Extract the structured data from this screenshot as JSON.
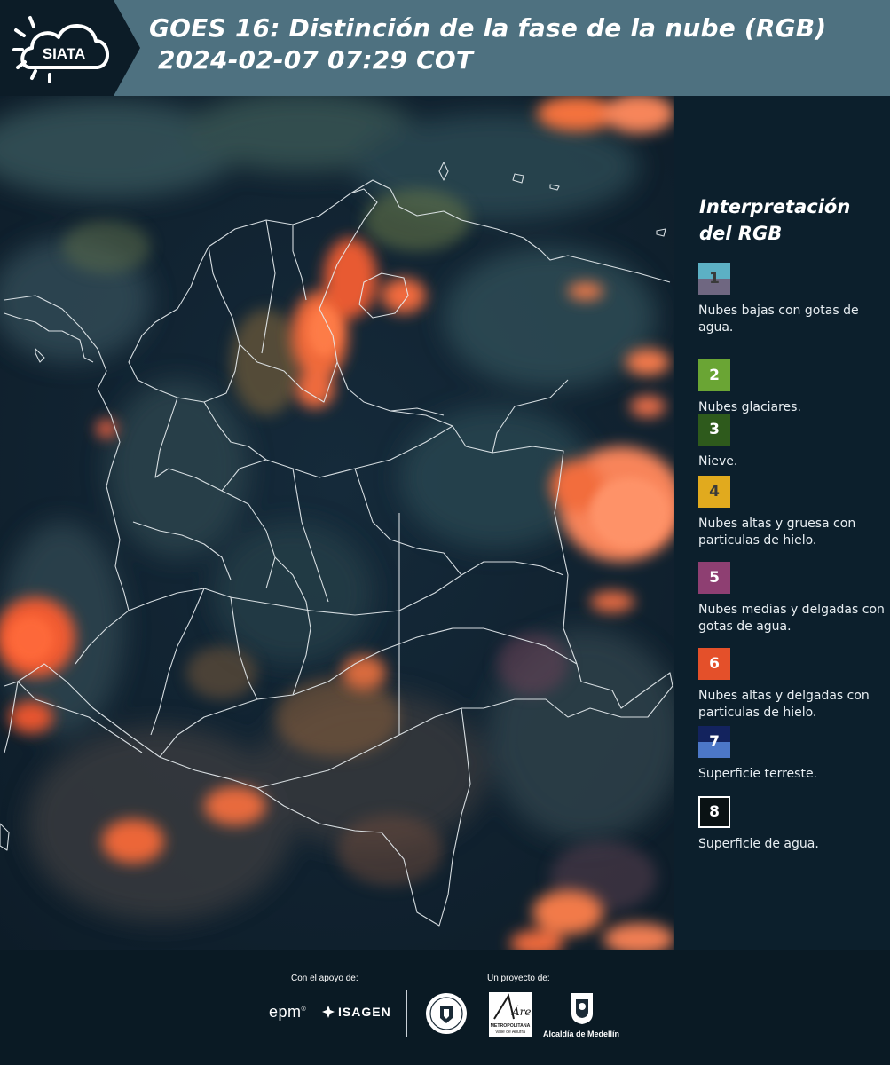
{
  "header": {
    "logo_text": "SIATA",
    "title_line1": "GOES 16: Distinción de la fase de la nube (RGB)",
    "title_line2": "2024-02-07 07:29 COT",
    "background_color": "#4e7180"
  },
  "legend": {
    "title_line1": "Interpretación",
    "title_line2": "del RGB",
    "items": [
      {
        "num": "1",
        "label": "Nubes bajas con gotas de agua.",
        "color_top": "#5cb0c4",
        "color_bottom": "#6f6781",
        "num_color": "#3a3a3a"
      },
      {
        "num": "2",
        "label": "Nubes glaciares.",
        "color_top": "#6aa534",
        "color_bottom": "#6aa534",
        "num_color": "#ffffff"
      },
      {
        "num": "3",
        "label": "Nieve.",
        "color_top": "#2e5a1c",
        "color_bottom": "#2e5a1c",
        "num_color": "#ffffff"
      },
      {
        "num": "4",
        "label": "Nubes altas y gruesa con particulas de hielo.",
        "color_top": "#e1aa1e",
        "color_bottom": "#e1aa1e",
        "num_color": "#3a3a3a"
      },
      {
        "num": "5",
        "label": "Nubes medias y delgadas con gotas de agua.",
        "color_top": "#8e3f72",
        "color_bottom": "#8e3f72",
        "num_color": "#ffffff"
      },
      {
        "num": "6",
        "label": "Nubes altas y delgadas con particulas de hielo.",
        "color_top": "#e4502a",
        "color_bottom": "#e4502a",
        "num_color": "#ffffff"
      },
      {
        "num": "7",
        "label": "Superficie terreste.",
        "color_top": "#13235e",
        "color_bottom": "#4c77c7",
        "num_color": "#ffffff"
      },
      {
        "num": "8",
        "label": "Superficie de agua.",
        "color_top": "#0a1214",
        "color_bottom": "#0a1214",
        "num_color": "#ffffff"
      }
    ]
  },
  "footer": {
    "support_label": "Con el apoyo de:",
    "project_label": "Un proyecto de:",
    "sponsor1": "epm",
    "sponsor2": "ISAGEN",
    "partner_area_title": "Área",
    "partner_area_sub1": "METROPOLITANA",
    "partner_area_sub2": "Valle de Aburrá",
    "partner_alcaldia": "Alcaldía de Medellín"
  }
}
